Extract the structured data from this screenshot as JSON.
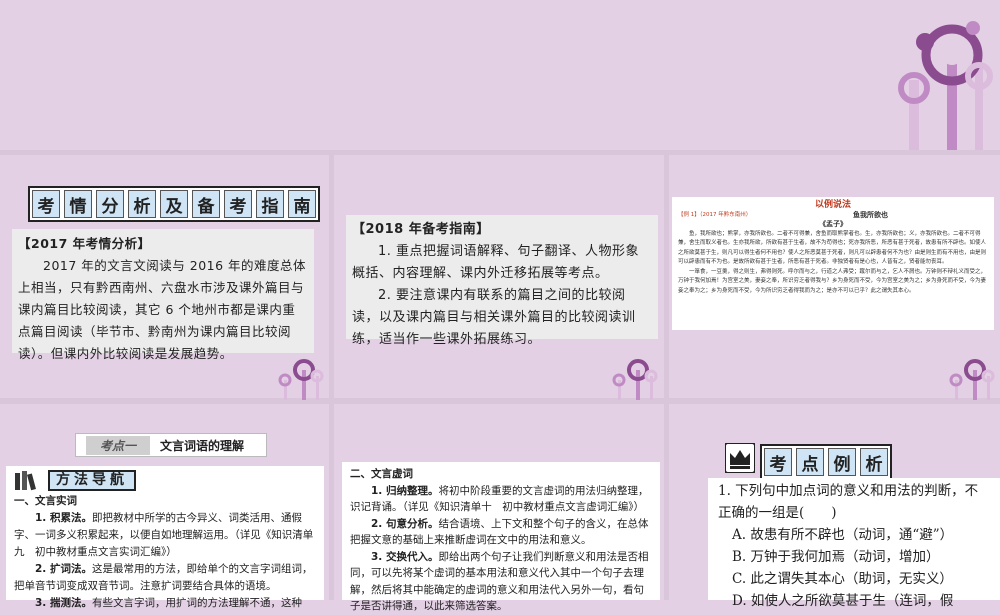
{
  "colors": {
    "background": "#e3d0e4",
    "flower_dark": "#8a4b8f",
    "flower_mid": "#c08bc4",
    "flower_light": "#dcbcdc",
    "title_cell": "#cfe5f5"
  },
  "panel1": {
    "title_chars": [
      "考",
      "情",
      "分",
      "析",
      "及",
      "备",
      "考",
      "指",
      "南"
    ],
    "head": "【2017 年考情分析】",
    "body": "2017 年的文言文阅读与 2016 年的难度总体上相当，只有黔西南州、六盘水市涉及课外篇目与课内篇目比较阅读，其它 6 个地州市都是课内重点篇目阅读（毕节市、黔南州为课内篇目比较阅读）。但课内外比较阅读是发展趋势。"
  },
  "panel2": {
    "head": "【2018 年备考指南】",
    "p1": "1. 重点把握词语解释、句子翻译、人物形象概括、内容理解、课内外迁移拓展等考点。",
    "p2": "2. 要注意课内有联系的篇目之间的比较阅读，以及课内篇目与相关课外篇目的比较阅读训练，适当作一些课外拓展练习。"
  },
  "panel3": {
    "badge": "以例说法",
    "example_tag": "【例 1】（2017 年黔东南州）",
    "title": "鱼我所欲也",
    "author": "《孟子》",
    "para1": "鱼，我所欲也；熊掌，亦我所欲也。二者不可得兼，舍鱼而取熊掌者也。生，亦我所欲也；义，亦我所欲也。二者不可得兼，舍生而取义者也。生亦我所欲，所欲有甚于生者，故不为苟得也；死亦我所恶，所恶有甚于死者，故患有所不辟也。如使人之所欲莫甚于生，则凡可以得生者何不用也？使人之所恶莫甚于死者，则凡可以辟患者何不为也？由是则生而有不用也，由是则可以辟患而有不为也。是故所欲有甚于生者，所恶有甚于死者。非独贤者有是心也，人皆有之，贤者能勿丧耳。",
    "para2": "一箪食，一豆羹，得之则生，弗得则死。呼尔而与之，行道之人弗受；蹴尔而与之，乞人不屑也。万钟则不辩礼义而受之，万钟于我何加焉！为宫室之美，妻妾之奉，所识穷乏者得我与？乡为身死而不受，今为宫室之美为之；乡为身死而不受，今为妻妾之奉为之；乡为身死而不受，今为所识穷乏者得我而为之；是亦不可以已乎？此之谓失其本心。"
  },
  "panel4": {
    "tag": "考点一",
    "title": "文言词语的理解",
    "method_title": "方法导航",
    "section1": "一、文言实词",
    "items": [
      {
        "label": "1. 积累法。",
        "text": "即把教材中所学的古今异义、词类活用、通假字、一词多义积累起来，以便自如地理解运用。（详见《知识清单九　初中教材重点文言实词汇编》）"
      },
      {
        "label": "2. 扩词法。",
        "text": "这是最常用的方法，即给单个的文言字词组词，把单音节词变成双音节词。注意扩词要结合具体的语境。"
      },
      {
        "label": "3. 揣测法。",
        "text": "有些文言字词，用扩词的方法理解不通，这种"
      }
    ]
  },
  "panel5": {
    "section2": "二、文言虚词",
    "items": [
      {
        "label": "1. 归纳整理。",
        "text": "将初中阶段重要的文言虚词的用法归纳整理，识记背诵。（详见《知识清单十　初中教材重点文言虚词汇编》）"
      },
      {
        "label": "2. 句意分析。",
        "text": "结合语境、上下文和整个句子的含义，在总体把握文意的基础上来推断虚词在文中的用法和意义。"
      },
      {
        "label": "3. 交换代入。",
        "text": "即给出两个句子让我们判断意义和用法是否相同，可以先将某个虚词的基本用法和意义代入其中一个句子去理解，然后将其中能确定的虚词的意义和用法代入另外一句，看句子是否讲得通，以此来筛选答案。"
      }
    ]
  },
  "panel6": {
    "title_chars": [
      "考",
      "点",
      "例",
      "析"
    ],
    "question": "1. 下列句中加点词的意义和用法的判断，不正确的一组是(　　)",
    "options": [
      "A. 故患有所不辟也（动词，通“避”）",
      "B. 万钟于我何加焉（动词，增加）",
      "C. 此之谓失其本心（助词，无实义）",
      "D. 如使人之所欲莫甚于生（连词，假"
    ]
  }
}
